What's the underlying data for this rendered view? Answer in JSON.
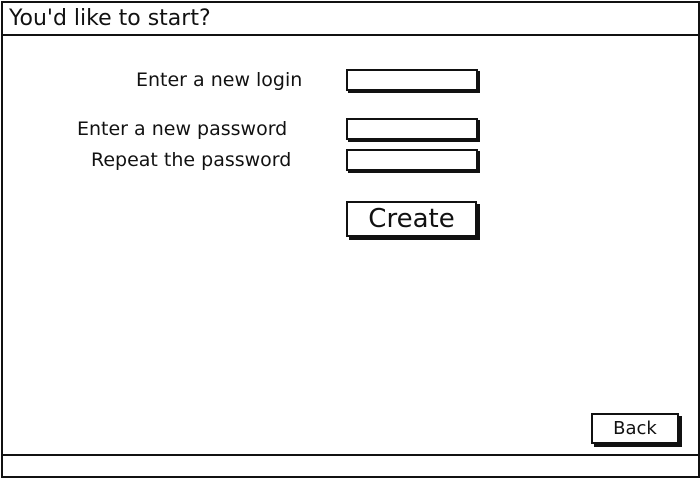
{
  "window": {
    "title": "You'd like to start?"
  },
  "form": {
    "login_label": "Enter a new login",
    "login_value": "",
    "password_label": "Enter a new password",
    "password_value": "",
    "repeat_label": "Repeat the password",
    "repeat_value": "",
    "create_label": "Create"
  },
  "footer": {
    "back_label": "Back"
  }
}
